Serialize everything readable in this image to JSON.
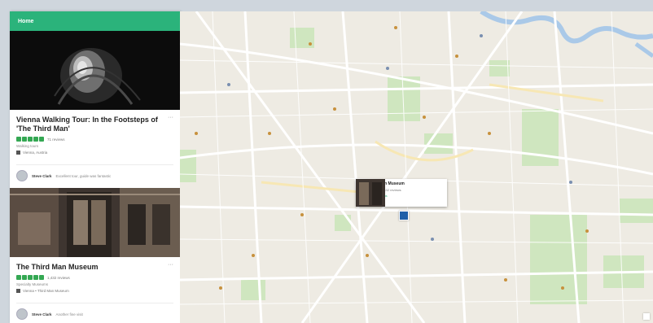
{
  "topbar": {
    "title": "Home"
  },
  "cards": [
    {
      "title": "Vienna Walking Tour: In the Footsteps of 'The Third Man'",
      "rating_text": "71 reviews",
      "meta": "Walking tours",
      "location": "Vienna, Austria",
      "review_name": "Steve Clark",
      "review_text": "Excellent tour, guide was fantastic",
      "more": "···"
    },
    {
      "title": "The Third Man Museum",
      "rating_text": "1,432 reviews",
      "meta": "Specialty Museums",
      "location": "Vienna • Third Man Museum",
      "review_name": "Steve Clark",
      "review_text": "Another fine visit",
      "more": "···"
    }
  ],
  "popup": {
    "title": "The Third Man Museum",
    "rating_text": "1,432 reviews",
    "sub": "Specialty Museums"
  },
  "colors": {
    "accent": "#2bb37b",
    "star": "#34a853",
    "marker": "#1f5fa8"
  }
}
